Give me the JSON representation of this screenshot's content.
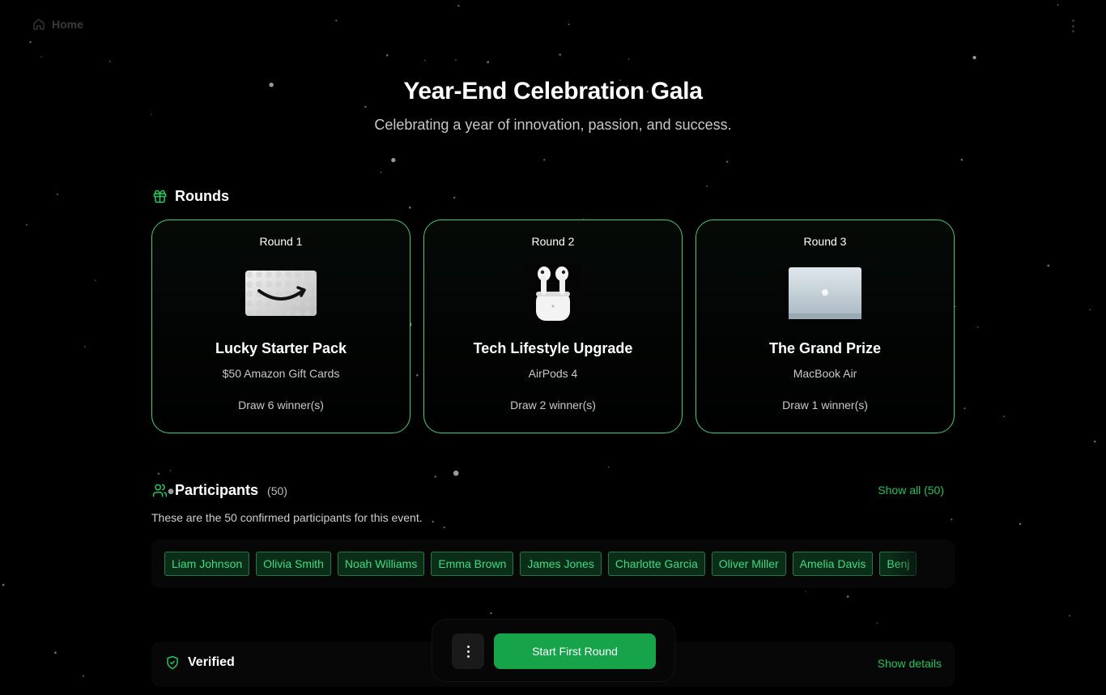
{
  "nav": {
    "home_label": "Home"
  },
  "event": {
    "title": "Year-End Celebration Gala",
    "subtitle": "Celebrating a year of innovation, passion, and success."
  },
  "rounds": {
    "heading": "Rounds",
    "items": [
      {
        "round": "Round 1",
        "name": "Lucky Starter Pack",
        "prize": "$50 Amazon Gift Cards",
        "draw": "Draw 6 winner(s)",
        "image": "amazon-gift-card"
      },
      {
        "round": "Round 2",
        "name": "Tech Lifestyle Upgrade",
        "prize": "AirPods 4",
        "draw": "Draw 2 winner(s)",
        "image": "airpods"
      },
      {
        "round": "Round 3",
        "name": "The Grand Prize",
        "prize": "MacBook Air",
        "draw": "Draw 1 winner(s)",
        "image": "macbook"
      }
    ]
  },
  "participants": {
    "heading": "Participants",
    "count": "(50)",
    "show_all": "Show all (50)",
    "description": "These are the 50 confirmed participants for this event.",
    "names": [
      "Liam Johnson",
      "Olivia Smith",
      "Noah Williams",
      "Emma Brown",
      "James Jones",
      "Charlotte Garcia",
      "Oliver Miller",
      "Amelia Davis",
      "Benj"
    ]
  },
  "verified": {
    "label": "Verified",
    "details": "Show details"
  },
  "actions": {
    "start_label": "Start First Round"
  },
  "colors": {
    "accent": "#22c55e",
    "button": "#16a34a",
    "card_border": "#3ccf7a",
    "chip_bg": "#0b2e19",
    "chip_text": "#3ddc84"
  }
}
